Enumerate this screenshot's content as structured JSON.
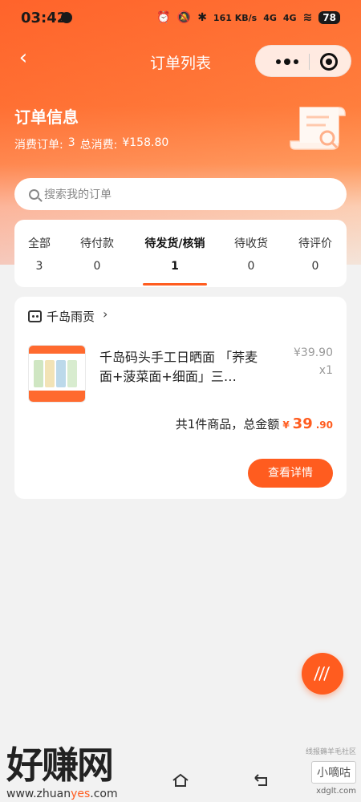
{
  "status_bar": {
    "time": "03:42",
    "network_speed": "161 KB/s",
    "signal_1": "4G",
    "signal_2": "4G",
    "battery": "78"
  },
  "nav": {
    "title": "订单列表"
  },
  "info": {
    "title": "订单信息",
    "orders_label": "消费订单:",
    "orders_count": "3",
    "total_label": "总消费:",
    "total_value": "¥158.80"
  },
  "search": {
    "placeholder": "搜索我的订单"
  },
  "tabs": [
    {
      "label": "全部",
      "count": "3"
    },
    {
      "label": "待付款",
      "count": "0"
    },
    {
      "label": "待发货/核销",
      "count": "1"
    },
    {
      "label": "待收货",
      "count": "0"
    },
    {
      "label": "待评价",
      "count": "0"
    }
  ],
  "active_tab": 2,
  "order": {
    "shop_name": "千岛雨贡",
    "product_title": "千岛码头手工日晒面 「荞麦面+菠菜面+细面」三…",
    "price": "¥39.90",
    "quantity": "x1",
    "summary_text": "共1件商品，总金额",
    "currency": "¥",
    "total_int": "39",
    "total_dec": ".90",
    "detail_button": "查看详情"
  },
  "watermark": {
    "brand": "好赚网",
    "url_prefix": "www.zhuan",
    "url_highlight": "yes",
    "url_suffix": ".com",
    "right_top": "线报薅羊毛社区",
    "right_mid": "小嘀咕",
    "right_url": "xdglt.com"
  },
  "colors": {
    "accent": "#ff5c1f",
    "header_orange": "#ff6a2f"
  }
}
